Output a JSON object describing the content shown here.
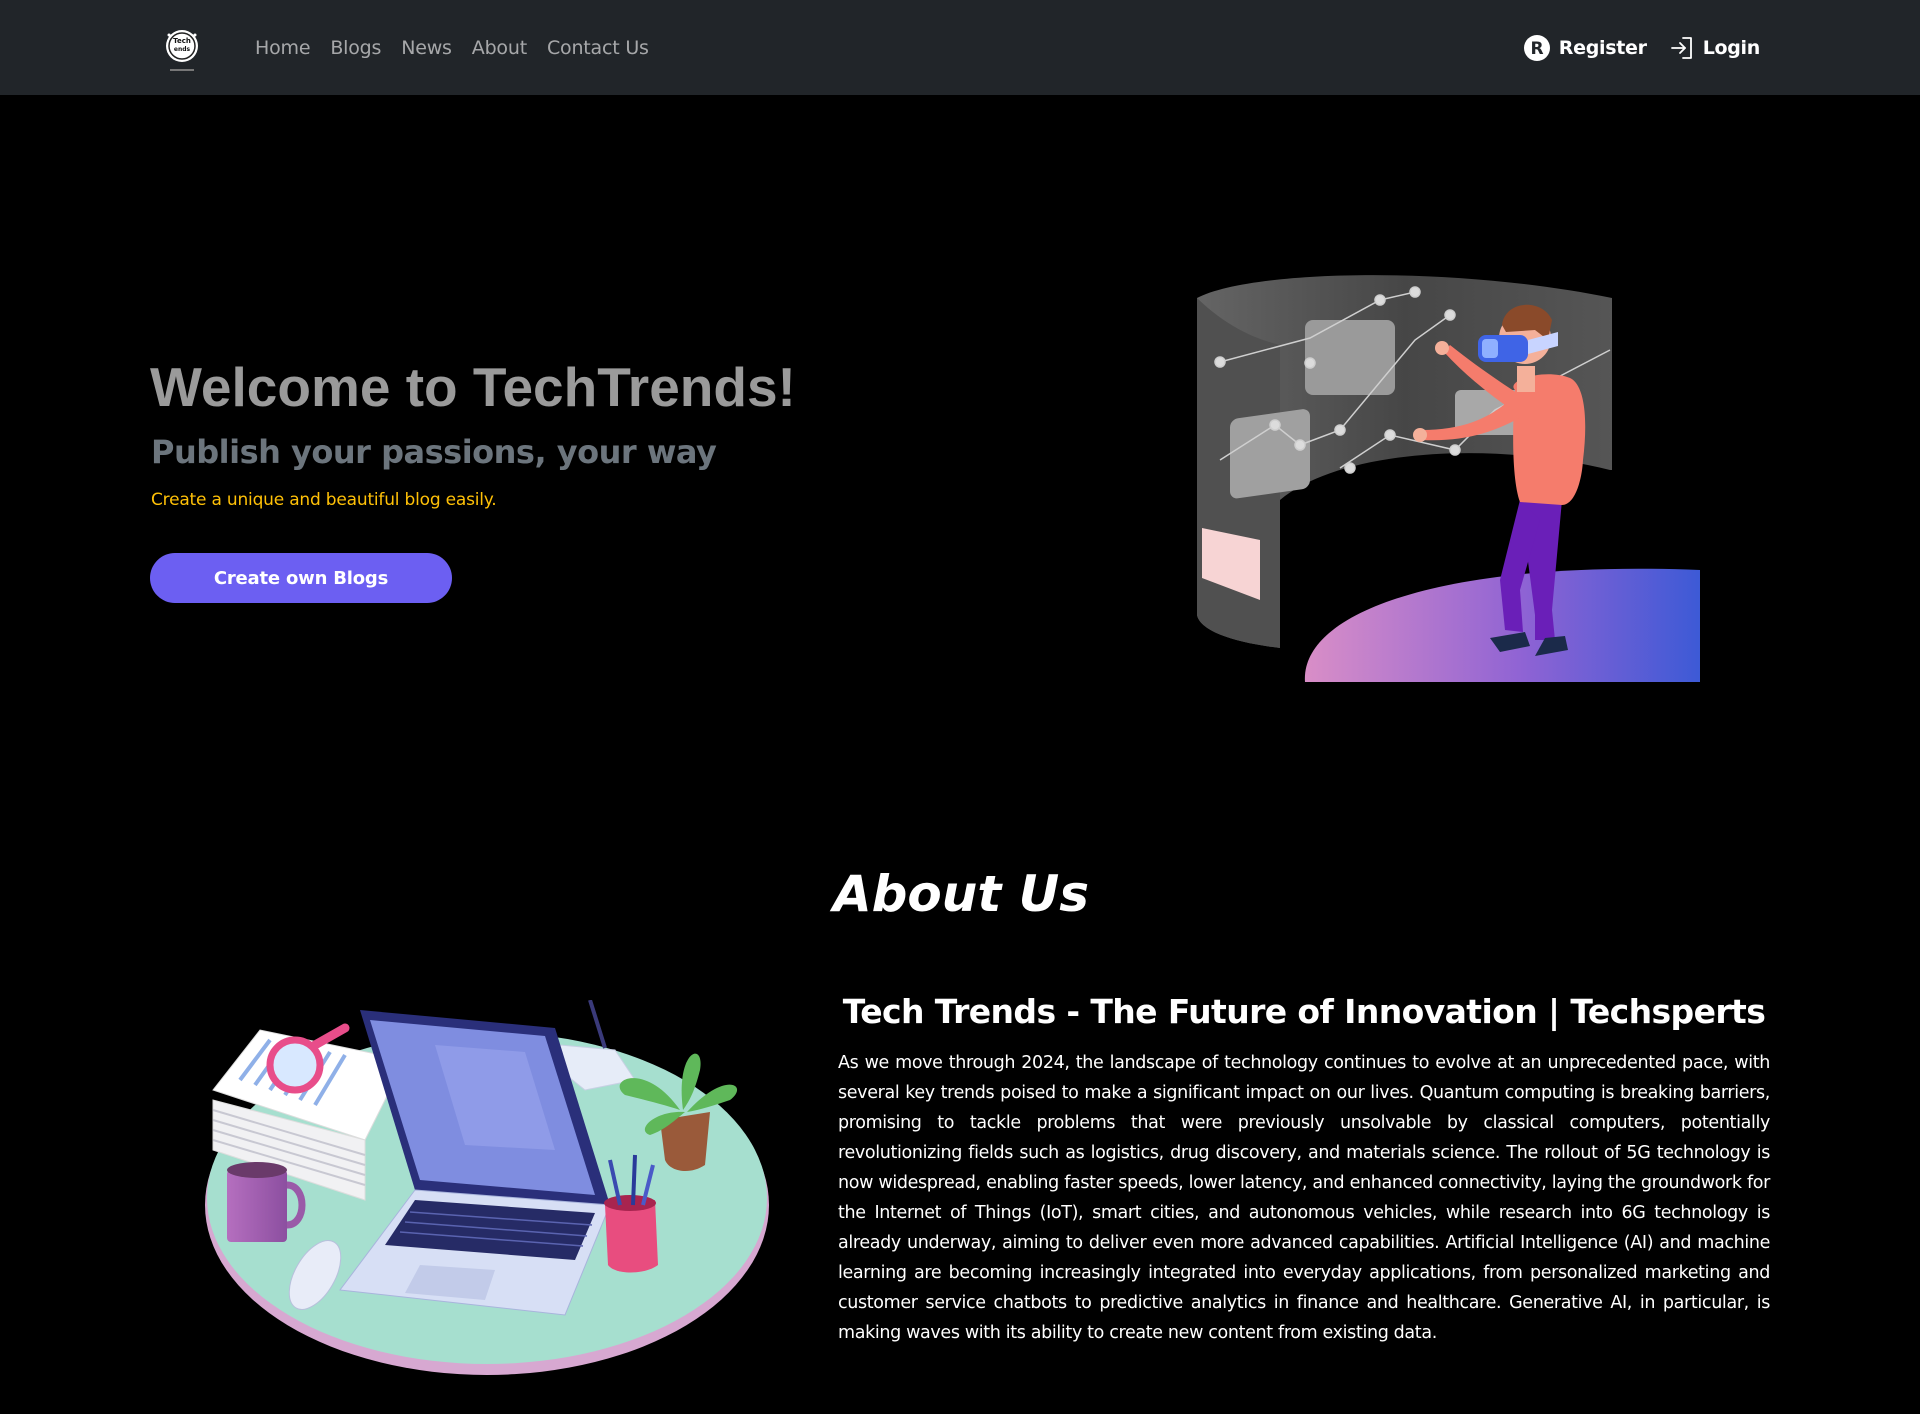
{
  "navbar": {
    "logo_text": "Tech Trends",
    "links": [
      "Home",
      "Blogs",
      "News",
      "About",
      "Contact Us"
    ],
    "register_label": "Register",
    "login_label": "Login"
  },
  "hero": {
    "title": "Welcome to TechTrends!",
    "subtitle": "Publish your passions, your way",
    "tagline": "Create a unique and beautiful blog easily.",
    "button_label": "Create own Blogs"
  },
  "about": {
    "heading": "About Us",
    "title": "Tech Trends - The Future of Innovation | Techsperts",
    "body": "As we move through 2024, the landscape of technology continues to evolve at an unprecedented pace, with several key trends poised to make a significant impact on our lives. Quantum computing is breaking barriers, promising to tackle problems that were previously unsolvable by classical computers, potentially revolutionizing fields such as logistics, drug discovery, and materials science. The rollout of 5G technology is now widespread, enabling faster speeds, lower latency, and enhanced connectivity, laying the groundwork for the Internet of Things (IoT), smart cities, and autonomous vehicles, while research into 6G technology is already underway, aiming to deliver even more advanced capabilities. Artificial Intelligence (AI) and machine learning are becoming increasingly integrated into everyday applications, from personalized marketing and customer service chatbots to predictive analytics in finance and healthcare. Generative AI, in particular, is making waves with its ability to create new content from existing data."
  },
  "colors": {
    "navbar_bg": "#212529",
    "page_bg": "#000000",
    "button_bg": "#6c5ff2",
    "tagline": "#ffc107",
    "subtitle": "#6c757d"
  },
  "icons": [
    "logo-icon",
    "register-r-icon",
    "login-arrow-icon",
    "vr-person-illustration",
    "laptop-desk-illustration"
  ]
}
